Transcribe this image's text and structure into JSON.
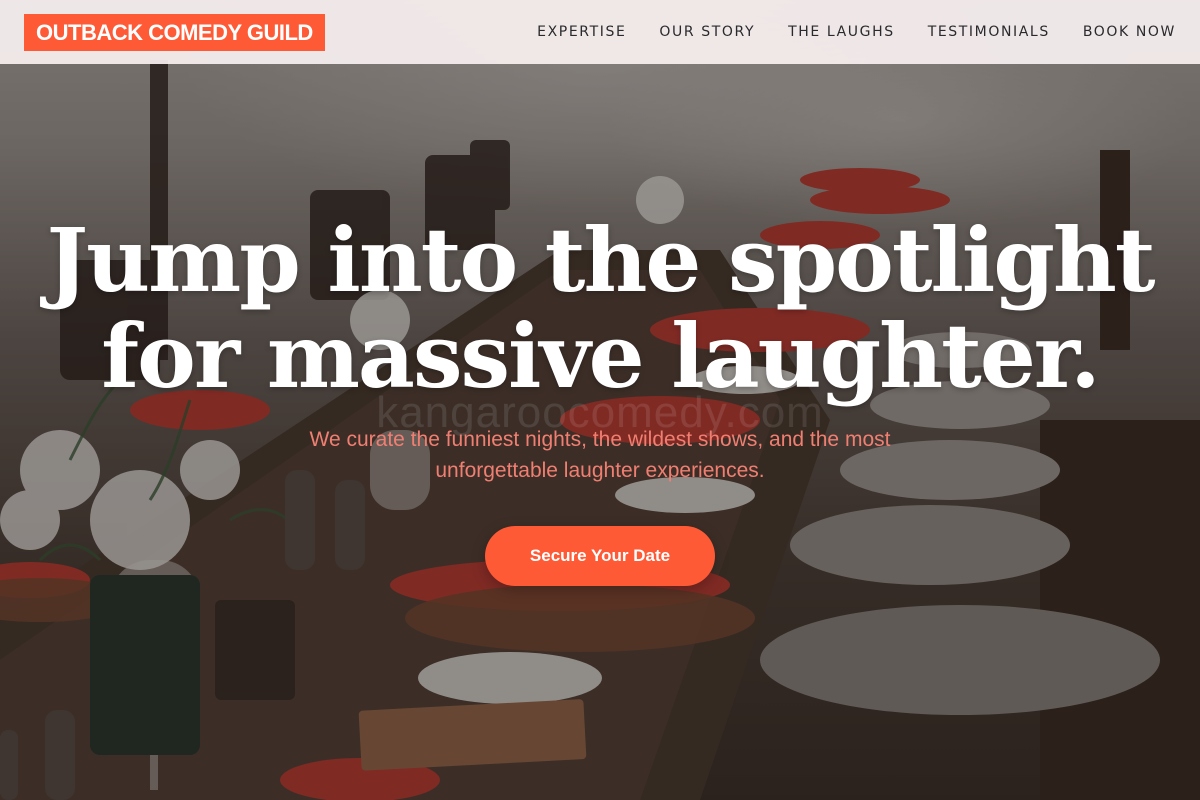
{
  "brand": {
    "name": "OUTBACK COMEDY GUILD",
    "accent_color": "#ff5a36"
  },
  "nav": {
    "items": [
      {
        "label": "EXPERTISE"
      },
      {
        "label": "OUR STORY"
      },
      {
        "label": "THE LAUGHS"
      },
      {
        "label": "TESTIMONIALS"
      },
      {
        "label": "BOOK NOW"
      }
    ]
  },
  "hero": {
    "headline_line1": "Jump into the spotlight",
    "headline_line2": "for massive laughter.",
    "watermark": "kangaroocomedy.com",
    "subtext": "We curate the funniest nights, the wildest shows, and the most unforgettable laughter experiences.",
    "cta_label": "Secure Your Date",
    "background_image": "outdoor-dining-table-photo",
    "subtext_color": "#f07f72"
  }
}
